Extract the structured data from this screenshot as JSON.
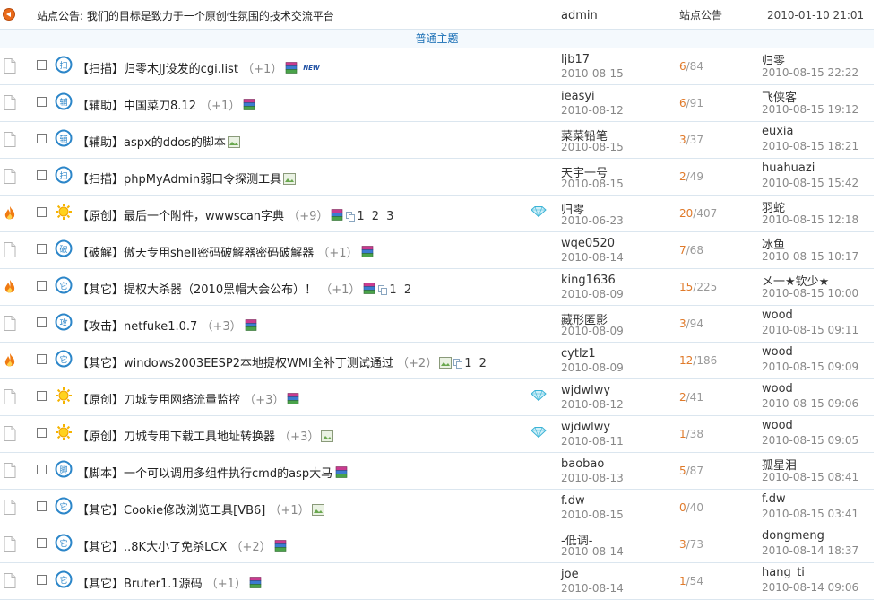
{
  "announcement": {
    "text": "站点公告: 我们的目标是致力于一个原创性氛围的技术交流平台",
    "author": "admin",
    "category": "站点公告",
    "time": "2010-01-10 21:01"
  },
  "section_label": "普通主题",
  "threads": [
    {
      "icon": "file",
      "type": "scan",
      "prefix": "【扫描】",
      "title": "归零木JJ设发的cgi.list",
      "plus": "（+1）",
      "attach": [
        "rar"
      ],
      "new": "NEW",
      "pages": "",
      "diamond": false,
      "author": "ljb17",
      "date": "2010-08-15",
      "replies": "6",
      "views": "/84",
      "last_user": "归零",
      "last_time": "2010-08-15 22:22"
    },
    {
      "icon": "file",
      "type": "aux",
      "prefix": "【辅助】",
      "title": "中国菜刀8.12",
      "plus": "（+1）",
      "attach": [
        "rar"
      ],
      "new": "",
      "pages": "",
      "diamond": false,
      "author": "ieasyi",
      "date": "2010-08-12",
      "replies": "6",
      "views": "/91",
      "last_user": "飞侠客",
      "last_time": "2010-08-15 19:12"
    },
    {
      "icon": "file",
      "type": "aux",
      "prefix": "【辅助】",
      "title": "aspx的ddos的脚本",
      "plus": "",
      "attach": [
        "img"
      ],
      "new": "",
      "pages": "",
      "diamond": false,
      "author": "菜菜铅笔",
      "date": "2010-08-15",
      "replies": "3",
      "views": "/37",
      "last_user": "euxia",
      "last_time": "2010-08-15 18:21"
    },
    {
      "icon": "file",
      "type": "scan",
      "prefix": "【扫描】",
      "title": "phpMyAdmin弱口令探测工具",
      "plus": "",
      "attach": [
        "img"
      ],
      "new": "",
      "pages": "",
      "diamond": false,
      "author": "天宇一号",
      "date": "2010-08-15",
      "replies": "2",
      "views": "/49",
      "last_user": "huahuazi",
      "last_time": "2010-08-15 15:42"
    },
    {
      "icon": "hot",
      "type": "sun",
      "prefix": "【原创】",
      "title": "最后一个附件，wwwscan字典",
      "plus": "（+9）",
      "attach": [
        "rar",
        "multi"
      ],
      "new": "",
      "pages": "1 2 3",
      "diamond": true,
      "author": "归零",
      "date": "2010-06-23",
      "replies": "20",
      "views": "/407",
      "last_user": "羽蛇",
      "last_time": "2010-08-15 12:18"
    },
    {
      "icon": "file",
      "type": "crack",
      "prefix": "【破解】",
      "title": "傲天专用shell密码破解器密码破解器",
      "plus": "（+1）",
      "attach": [
        "rar"
      ],
      "new": "",
      "pages": "",
      "diamond": false,
      "author": "wqe0520",
      "date": "2010-08-14",
      "replies": "7",
      "views": "/68",
      "last_user": "冰鱼",
      "last_time": "2010-08-15 10:17"
    },
    {
      "icon": "hot",
      "type": "other",
      "prefix": "【其它】",
      "title": "提权大杀器（2010黑帽大会公布）！",
      "plus": "（+1）",
      "attach": [
        "rar",
        "multi"
      ],
      "new": "",
      "pages": "1 2",
      "diamond": false,
      "author": "king1636",
      "date": "2010-08-09",
      "replies": "15",
      "views": "/225",
      "last_user": "メ一★钦少★",
      "last_time": "2010-08-15 10:00"
    },
    {
      "icon": "file",
      "type": "attack",
      "prefix": "【攻击】",
      "title": "netfuke1.0.7",
      "plus": "（+3）",
      "attach": [
        "rar"
      ],
      "new": "",
      "pages": "",
      "diamond": false,
      "author": "藏形匿影",
      "date": "2010-08-09",
      "replies": "3",
      "views": "/94",
      "last_user": "wood",
      "last_time": "2010-08-15 09:11"
    },
    {
      "icon": "hot",
      "type": "other",
      "prefix": "【其它】",
      "title": "windows2003EESP2本地提权WMI全补丁测试通过",
      "plus": "（+2）",
      "attach": [
        "img",
        "multi"
      ],
      "new": "",
      "pages": "1 2",
      "diamond": false,
      "author": "cytlz1",
      "date": "2010-08-09",
      "replies": "12",
      "views": "/186",
      "last_user": "wood",
      "last_time": "2010-08-15 09:09"
    },
    {
      "icon": "file",
      "type": "sun",
      "prefix": "【原创】",
      "title": "刀城专用网络流量监控",
      "plus": "（+3）",
      "attach": [
        "rar"
      ],
      "new": "",
      "pages": "",
      "diamond": true,
      "author": "wjdwlwy",
      "date": "2010-08-12",
      "replies": "2",
      "views": "/41",
      "last_user": "wood",
      "last_time": "2010-08-15 09:06"
    },
    {
      "icon": "file",
      "type": "sun",
      "prefix": "【原创】",
      "title": "刀城专用下载工具地址转换器",
      "plus": "（+3）",
      "attach": [
        "img"
      ],
      "new": "",
      "pages": "",
      "diamond": true,
      "author": "wjdwlwy",
      "date": "2010-08-11",
      "replies": "1",
      "views": "/38",
      "last_user": "wood",
      "last_time": "2010-08-15 09:05"
    },
    {
      "icon": "file",
      "type": "script",
      "prefix": "【脚本】",
      "title": "一个可以调用多组件执行cmd的asp大马",
      "plus": "",
      "attach": [
        "rar"
      ],
      "new": "",
      "pages": "",
      "diamond": false,
      "author": "baobao",
      "date": "2010-08-13",
      "replies": "5",
      "views": "/87",
      "last_user": "孤星泪",
      "last_time": "2010-08-15 08:41"
    },
    {
      "icon": "file",
      "type": "other",
      "prefix": "【其它】",
      "title": "Cookie修改浏览工具[VB6]",
      "plus": "（+1）",
      "attach": [
        "img"
      ],
      "new": "",
      "pages": "",
      "diamond": false,
      "author": "f.dw",
      "date": "2010-08-15",
      "replies": "0",
      "views": "/40",
      "last_user": "f.dw",
      "last_time": "2010-08-15 03:41"
    },
    {
      "icon": "file",
      "type": "other",
      "prefix": "【其它】",
      "title": "..8K大小了免杀LCX",
      "plus": "（+2）",
      "attach": [
        "rar"
      ],
      "new": "",
      "pages": "",
      "diamond": false,
      "author": "-低调-",
      "date": "2010-08-14",
      "replies": "3",
      "views": "/73",
      "last_user": "dongmeng",
      "last_time": "2010-08-14 18:37"
    },
    {
      "icon": "file",
      "type": "other",
      "prefix": "【其它】",
      "title": "Bruter1.1源码",
      "plus": "（+1）",
      "attach": [
        "rar"
      ],
      "new": "",
      "pages": "",
      "diamond": false,
      "author": "joe",
      "date": "2010-08-14",
      "replies": "1",
      "views": "/54",
      "last_user": "hang_ti",
      "last_time": "2010-08-14 09:06"
    }
  ]
}
